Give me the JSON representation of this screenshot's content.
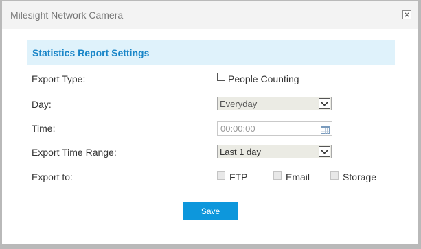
{
  "window": {
    "title": "Milesight Network Camera"
  },
  "section": {
    "title": "Statistics Report Settings"
  },
  "form": {
    "export_type": {
      "label": "Export Type:",
      "option_label": "People Counting",
      "checked": false
    },
    "day": {
      "label": "Day:",
      "value": "Everyday"
    },
    "time": {
      "label": "Time:",
      "value": "00:00:00"
    },
    "export_time_range": {
      "label": "Export Time Range:",
      "value": "Last 1 day"
    },
    "export_to": {
      "label": "Export to:",
      "options": [
        {
          "label": "FTP",
          "checked": false
        },
        {
          "label": "Email",
          "checked": false
        },
        {
          "label": "Storage",
          "checked": false
        }
      ]
    }
  },
  "actions": {
    "save_label": "Save"
  },
  "colors": {
    "accent": "#0d97dc",
    "section_bg": "#dff2fb",
    "section_title": "#1a86c8",
    "frame": "#b9b9b9"
  },
  "icons": {
    "close": "close-icon",
    "dropdown": "chevron-down-icon",
    "calendar": "calendar-icon"
  }
}
